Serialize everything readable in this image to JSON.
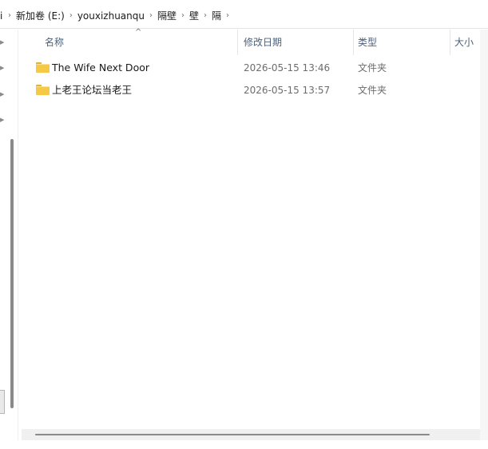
{
  "breadcrumb": {
    "items": [
      {
        "label": "新加卷 (E:)"
      },
      {
        "label": "youxizhuanqu"
      },
      {
        "label": "隔壁"
      },
      {
        "label": "壁"
      },
      {
        "label": "隔"
      }
    ]
  },
  "columns": {
    "name": "名称",
    "modified": "修改日期",
    "type": "类型",
    "size": "大小"
  },
  "files": [
    {
      "name": "The Wife Next Door",
      "modified": "2026-05-15 13:46",
      "type": "文件夹"
    },
    {
      "name": "上老王论坛当老王",
      "modified": "2026-05-15 13:57",
      "type": "文件夹"
    }
  ],
  "colors": {
    "folder": "#f5c946",
    "header_text": "#4c607a",
    "muted_text": "#6d6d6d"
  }
}
